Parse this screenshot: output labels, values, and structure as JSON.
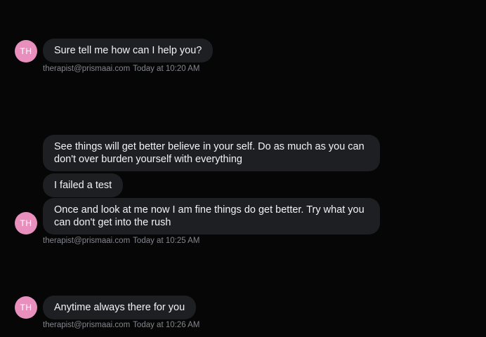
{
  "groups": [
    {
      "avatar_initials": "TH",
      "messages": [
        "Sure tell me how can I help you?"
      ],
      "sender": "therapist@prismaai.com",
      "timestamp": "Today at 10:20 AM"
    },
    {
      "avatar_initials": "TH",
      "messages": [
        "See things will get better believe in your self. Do as much as you can don't over burden yourself with everything",
        "I failed a test",
        "Once and look at me now I am fine things do get better. Try what you can don't get into the rush"
      ],
      "sender": "therapist@prismaai.com",
      "timestamp": "Today at 10:25 AM"
    },
    {
      "avatar_initials": "TH",
      "messages": [
        "Anytime always there for you"
      ],
      "sender": "therapist@prismaai.com",
      "timestamp": "Today at 10:26 AM"
    }
  ],
  "colors": {
    "background": "#060607",
    "bubble": "#1e1f22",
    "avatar": "#e98fbe",
    "meta_text": "#84868d"
  }
}
